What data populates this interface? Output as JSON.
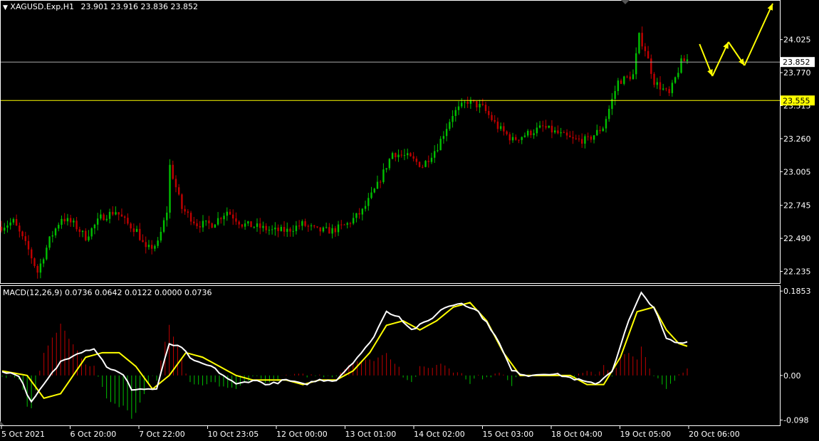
{
  "header": {
    "symbol": "XAGUSD.Exp,H1",
    "ohlc": "23.901 23.916 23.836 23.852",
    "macd_label": "MACD(12,26,9) 0.0736 0.0642 0.0122 0.0000 0.0736"
  },
  "colors": {
    "background": "#000000",
    "bull": "#00c000",
    "bear": "#c00000",
    "macd_line": "#ffffff",
    "signal_line": "#ffff00",
    "arrow": "#ffff00",
    "bid_line": "#aaaaaa",
    "level_line": "#ffff00"
  },
  "chart_data": [
    {
      "type": "candlestick",
      "name": "price",
      "x_ticks": [
        "5 Oct 2021",
        "6 Oct 20:00",
        "7 Oct 22:00",
        "10 Oct 23:05",
        "12 Oct 00:00",
        "13 Oct 01:00",
        "14 Oct 02:00",
        "15 Oct 03:00",
        "18 Oct 04:00",
        "19 Oct 05:00",
        "20 Oct 06:00"
      ],
      "y_ticks": [
        "24.025",
        "23.770",
        "23.515",
        "23.260",
        "23.005",
        "22.745",
        "22.490",
        "22.235"
      ],
      "ylim": [
        22.15,
        24.32
      ],
      "last_price": 23.852,
      "last_price_label": "23.852",
      "level": 23.555,
      "level_label": "23.555",
      "bars": 200,
      "anchors": [
        [
          0,
          22.58
        ],
        [
          4,
          22.62
        ],
        [
          9,
          22.4
        ],
        [
          12,
          22.23
        ],
        [
          16,
          22.48
        ],
        [
          20,
          22.65
        ],
        [
          24,
          22.6
        ],
        [
          28,
          22.5
        ],
        [
          33,
          22.65
        ],
        [
          38,
          22.7
        ],
        [
          42,
          22.6
        ],
        [
          45,
          22.55
        ],
        [
          48,
          22.4
        ],
        [
          52,
          22.45
        ],
        [
          55,
          22.7
        ],
        [
          56,
          23.05
        ],
        [
          60,
          22.72
        ],
        [
          65,
          22.6
        ],
        [
          70,
          22.6
        ],
        [
          75,
          22.7
        ],
        [
          80,
          22.6
        ],
        [
          85,
          22.58
        ],
        [
          90,
          22.55
        ],
        [
          95,
          22.55
        ],
        [
          100,
          22.6
        ],
        [
          105,
          22.55
        ],
        [
          110,
          22.55
        ],
        [
          115,
          22.6
        ],
        [
          120,
          22.7
        ],
        [
          125,
          22.9
        ],
        [
          130,
          23.15
        ],
        [
          135,
          23.12
        ],
        [
          140,
          23.05
        ],
        [
          145,
          23.2
        ],
        [
          150,
          23.45
        ],
        [
          155,
          23.55
        ],
        [
          160,
          23.5
        ],
        [
          165,
          23.35
        ],
        [
          170,
          23.25
        ],
        [
          175,
          23.3
        ],
        [
          180,
          23.35
        ],
        [
          185,
          23.3
        ],
        [
          190,
          23.25
        ],
        [
          195,
          23.25
        ],
        [
          200,
          23.35
        ],
        [
          205,
          23.7
        ],
        [
          210,
          23.75
        ],
        [
          212,
          24.05
        ],
        [
          214,
          23.95
        ],
        [
          217,
          23.7
        ],
        [
          222,
          23.6
        ],
        [
          226,
          23.85
        ],
        [
          228,
          23.87
        ]
      ],
      "forecast_arrows": [
        [
          [
            1090,
            60
          ],
          [
            1110,
            105
          ]
        ],
        [
          [
            1110,
            105
          ],
          [
            1135,
            57
          ]
        ],
        [
          [
            1135,
            57
          ],
          [
            1160,
            90
          ]
        ],
        [
          [
            1160,
            90
          ],
          [
            1204,
            3
          ]
        ]
      ]
    },
    {
      "type": "macd",
      "name": "MACD(12,26,9)",
      "y_ticks": [
        "0.1853",
        "0.00",
        "-0.098"
      ],
      "ylim": [
        -0.108,
        0.195
      ],
      "macd_anchors": [
        [
          0,
          0.01
        ],
        [
          4,
          0.0
        ],
        [
          7,
          -0.06
        ],
        [
          10,
          -0.02
        ],
        [
          14,
          0.03
        ],
        [
          18,
          0.05
        ],
        [
          22,
          0.06
        ],
        [
          25,
          0.02
        ],
        [
          29,
          0.0
        ],
        [
          31,
          -0.03
        ],
        [
          37,
          -0.03
        ],
        [
          40,
          0.07
        ],
        [
          43,
          0.06
        ],
        [
          46,
          0.03
        ],
        [
          50,
          0.02
        ],
        [
          53,
          0.0
        ],
        [
          56,
          -0.02
        ],
        [
          60,
          -0.01
        ],
        [
          64,
          -0.02
        ],
        [
          68,
          -0.01
        ],
        [
          72,
          -0.02
        ],
        [
          76,
          -0.01
        ],
        [
          80,
          -0.01
        ],
        [
          84,
          0.03
        ],
        [
          88,
          0.07
        ],
        [
          92,
          0.14
        ],
        [
          95,
          0.13
        ],
        [
          98,
          0.1
        ],
        [
          102,
          0.12
        ],
        [
          106,
          0.15
        ],
        [
          110,
          0.16
        ],
        [
          114,
          0.14
        ],
        [
          118,
          0.09
        ],
        [
          122,
          0.01
        ],
        [
          126,
          0.0
        ],
        [
          130,
          0.005
        ],
        [
          134,
          0.0
        ],
        [
          138,
          -0.01
        ],
        [
          142,
          -0.02
        ],
        [
          146,
          0.01
        ],
        [
          150,
          0.12
        ],
        [
          153,
          0.18
        ],
        [
          156,
          0.15
        ],
        [
          159,
          0.08
        ],
        [
          162,
          0.07
        ],
        [
          164,
          0.0736
        ]
      ],
      "signal_anchors": [
        [
          0,
          0.01
        ],
        [
          6,
          0.0
        ],
        [
          10,
          -0.05
        ],
        [
          14,
          -0.04
        ],
        [
          20,
          0.04
        ],
        [
          24,
          0.05
        ],
        [
          28,
          0.05
        ],
        [
          32,
          0.02
        ],
        [
          36,
          -0.03
        ],
        [
          40,
          0.0
        ],
        [
          44,
          0.05
        ],
        [
          48,
          0.04
        ],
        [
          52,
          0.02
        ],
        [
          56,
          0.0
        ],
        [
          60,
          -0.01
        ],
        [
          64,
          -0.01
        ],
        [
          68,
          -0.01
        ],
        [
          72,
          -0.02
        ],
        [
          76,
          -0.01
        ],
        [
          80,
          -0.01
        ],
        [
          84,
          0.01
        ],
        [
          88,
          0.05
        ],
        [
          92,
          0.11
        ],
        [
          96,
          0.12
        ],
        [
          100,
          0.1
        ],
        [
          104,
          0.12
        ],
        [
          108,
          0.15
        ],
        [
          112,
          0.16
        ],
        [
          116,
          0.12
        ],
        [
          120,
          0.05
        ],
        [
          124,
          0.0
        ],
        [
          128,
          0.0
        ],
        [
          132,
          0.0
        ],
        [
          136,
          0.0
        ],
        [
          140,
          -0.02
        ],
        [
          144,
          -0.02
        ],
        [
          148,
          0.04
        ],
        [
          152,
          0.14
        ],
        [
          156,
          0.15
        ],
        [
          159,
          0.1
        ],
        [
          162,
          0.07
        ],
        [
          164,
          0.0642
        ]
      ],
      "bars": 165
    }
  ]
}
